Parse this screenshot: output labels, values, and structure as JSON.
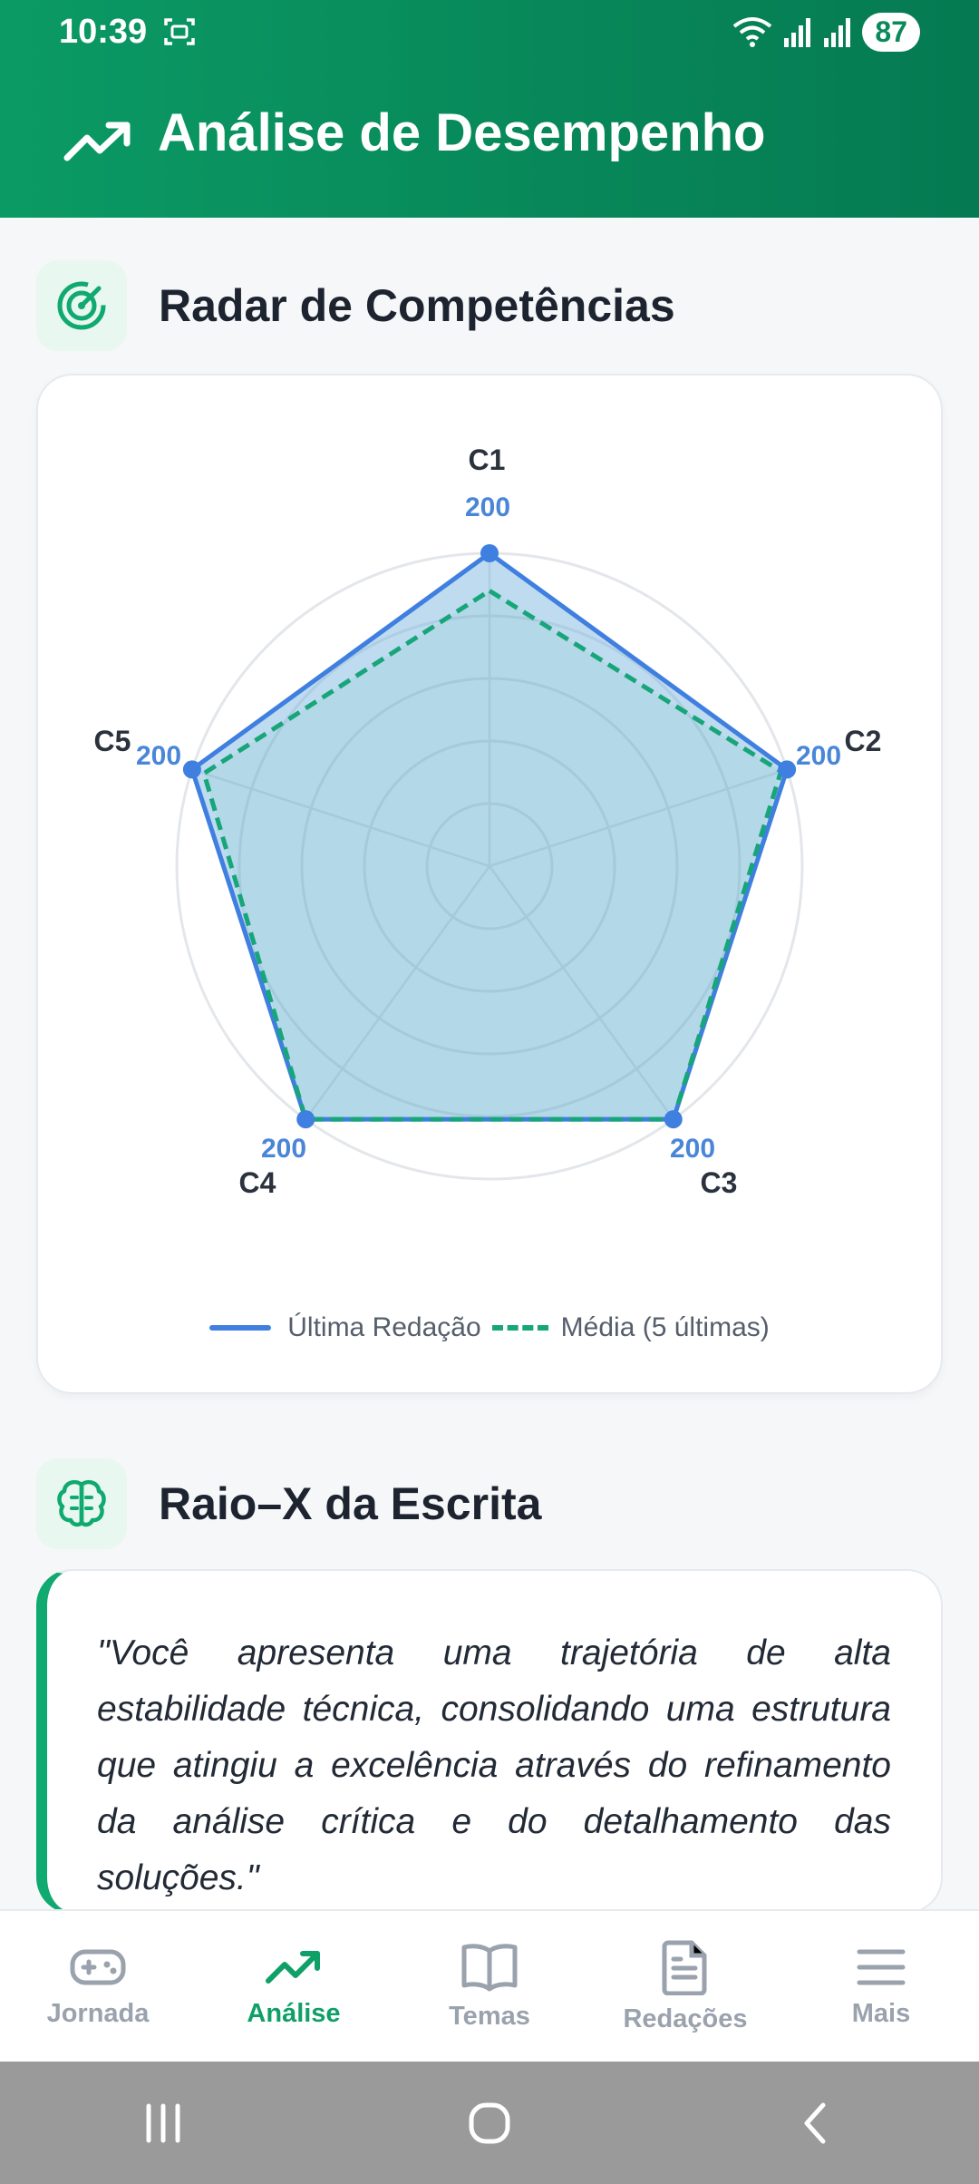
{
  "status": {
    "time": "10:39",
    "battery": "87"
  },
  "header": {
    "title": "Análise de Desempenho"
  },
  "radar": {
    "section_title": "Radar de Competências",
    "legend": {
      "latest": "Última Redação",
      "average": "Média (5 últimas)"
    }
  },
  "chart_data": {
    "type": "radar",
    "categories": [
      "C1",
      "C2",
      "C3",
      "C4",
      "C5"
    ],
    "max": 200,
    "series": [
      {
        "name": "Última Redação",
        "values": [
          200,
          200,
          200,
          200,
          200
        ],
        "color": "#3f7fe0"
      },
      {
        "name": "Média (5 últimas)",
        "values": [
          176,
          196,
          200,
          200,
          192
        ],
        "color": "#17a57a"
      }
    ],
    "value_labels": [
      "200",
      "200",
      "200",
      "200",
      "200"
    ]
  },
  "xray": {
    "section_title": "Raio–X da Escrita",
    "quote": "\"Você apresenta uma trajetória de alta estabilidade técnica, consolidando uma estrutura que atingiu a excelência através do refinamento da análise crítica e do detalhamento das soluções.\""
  },
  "nav": {
    "items": [
      {
        "label": "Jornada"
      },
      {
        "label": "Análise"
      },
      {
        "label": "Temas"
      },
      {
        "label": "Redações"
      },
      {
        "label": "Mais"
      }
    ]
  },
  "colors": {
    "brand": "#0b9a64",
    "active": "#0fa068",
    "series_latest": "#3f7fe0",
    "series_avg": "#17a57a"
  }
}
